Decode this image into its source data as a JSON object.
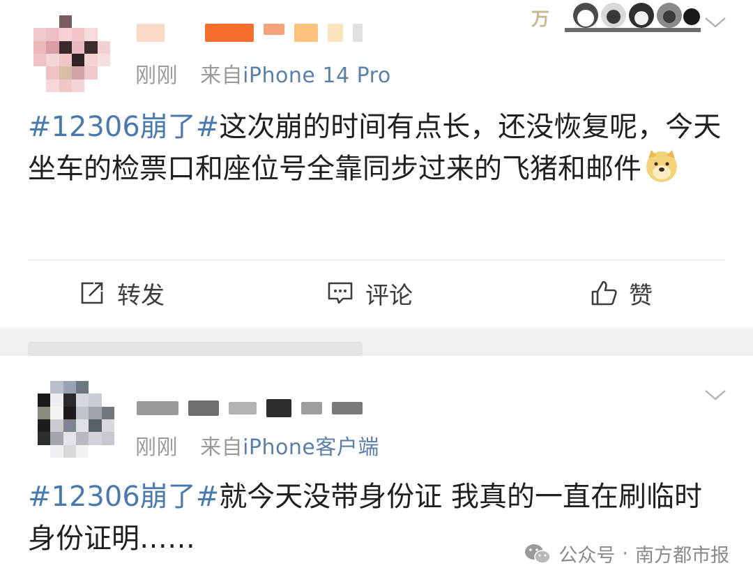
{
  "posts": [
    {
      "time": "刚刚",
      "source_prefix": "来自",
      "source": "iPhone 14 Pro",
      "hashtag": "#12306崩了#",
      "text": "这次崩的时间有点长，还没恢复呢，今天坐车的检票口和座位号全靠同步过来的飞猪和邮件"
    },
    {
      "time": "刚刚",
      "source_prefix": "来自",
      "source": "iPhone客户端",
      "hashtag": "#12306崩了#",
      "text": "就今天没带身份证 我真的一直在刷临时身份证明……"
    }
  ],
  "actions": {
    "repost": "转发",
    "comment": "评论",
    "like": "赞"
  },
  "watermark": {
    "platform": "公众号",
    "separator": "·",
    "account": "南方都市报"
  },
  "icons": [
    "chevron-down-icon",
    "repost-icon",
    "comment-icon",
    "like-icon",
    "doge-emoji-icon",
    "wechat-icon"
  ],
  "colors": {
    "hashtag": "#4a79ad",
    "source": "#5b7fa8",
    "meta": "#9a9a9a",
    "body": "#1f1f1f"
  }
}
